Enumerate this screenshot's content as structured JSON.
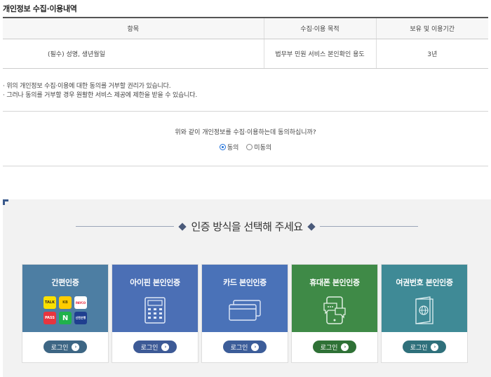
{
  "section_title": "개인정보 수집·이용내역",
  "table": {
    "headers": [
      "항목",
      "수집·이용 목적",
      "보유 및 이용기간"
    ],
    "row": [
      "(필수) 성명, 생년월일",
      "법무부 민원 서비스 본인확인 용도",
      "3년"
    ]
  },
  "notes": [
    "· 위의 개인정보 수집·이용에 대한 동의를 거부할 권리가 있습니다.",
    "· 그러나 동의를 거부할 경우 원활한 서비스 제공에 제한을 받을 수 있습니다."
  ],
  "consent": {
    "question": "위와 같이 개인정보를 수집·이용하는데 동의하십니까?",
    "agree": "동의",
    "disagree": "미동의",
    "selected": "agree"
  },
  "auth": {
    "heading": "인증 방식을 선택해 주세요",
    "cards": [
      {
        "label": "간편인증",
        "button": "로그인",
        "color": "#4d7ea3",
        "btn_color": "#3d6684"
      },
      {
        "label": "아이핀 본인인증",
        "button": "로그인",
        "color": "#4b6fb5",
        "btn_color": "#3d5a96"
      },
      {
        "label": "카드 본인인증",
        "button": "로그인",
        "color": "#4a72b8",
        "btn_color": "#3c5d99"
      },
      {
        "label": "휴대폰 본인인증",
        "button": "로그인",
        "color": "#3f8a47",
        "btn_color": "#2f7136"
      },
      {
        "label": "여권번호 본인인증",
        "button": "로그인",
        "color": "#3f8a96",
        "btn_color": "#2f707b"
      }
    ],
    "simple_auth_badges": [
      {
        "text": "TALK",
        "bg": "#f9e000",
        "fg": "#3b2a1a"
      },
      {
        "text": "KB",
        "bg": "#ffcc00",
        "fg": "#5a4a00"
      },
      {
        "text": "PAYCO",
        "bg": "#ffffff",
        "fg": "#e6223a"
      },
      {
        "text": "PASS",
        "bg": "#e8343e",
        "fg": "#ffffff"
      },
      {
        "text": "N",
        "bg": "#20b24b",
        "fg": "#ffffff"
      },
      {
        "text": "신한은행",
        "bg": "#1f3f8f",
        "fg": "#ffffff"
      }
    ]
  }
}
